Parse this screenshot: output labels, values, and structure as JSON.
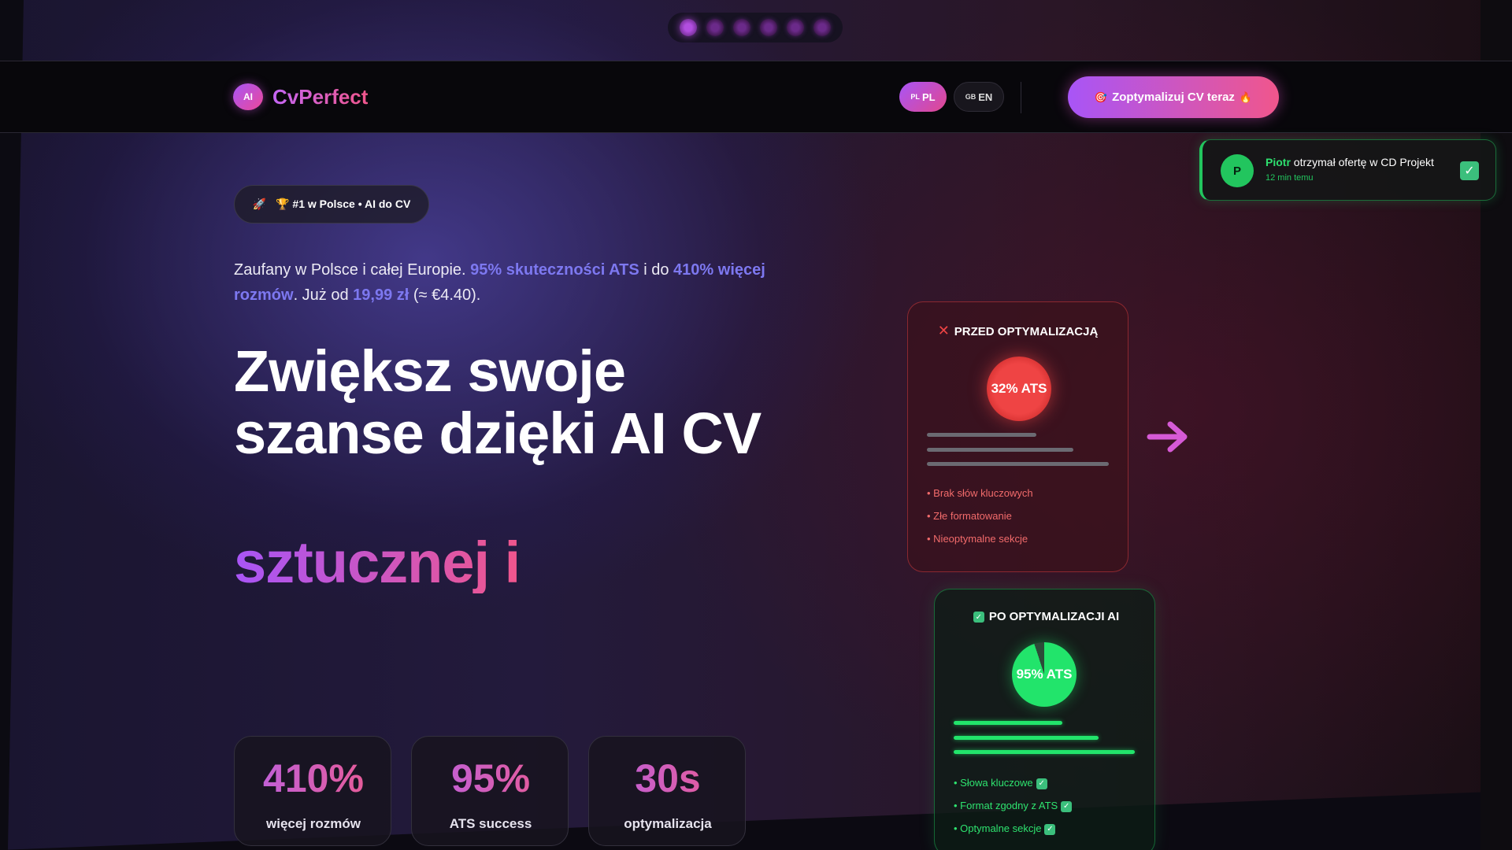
{
  "slider": {
    "dots": 6,
    "active_index": 0
  },
  "header": {
    "logo_badge": "AI",
    "logo_text": "CvPerfect",
    "lang_pl_flag": "PL",
    "lang_pl": "PL",
    "lang_en_flag": "GB",
    "lang_en": "EN",
    "cta_icon": "🎯",
    "cta_label": "Zoptymalizuj CV teraz",
    "cta_icon_end": "🔥"
  },
  "toast": {
    "avatar": "P",
    "name": "Piotr",
    "message": "otrzymał ofertę w CD Projekt",
    "time": "12 min temu",
    "check": "✓"
  },
  "hero": {
    "badge_icon": "🚀",
    "badge_text": "🏆 #1 w Polsce • AI do CV",
    "lead_1": "Zaufany w Polsce i całej Europie. ",
    "lead_hl_1": "95% skuteczności ATS",
    "lead_2": " i do ",
    "lead_hl_2": "410% więcej rozmów",
    "lead_3": ". Już od ",
    "lead_hl_3": "19,99 zł",
    "lead_4": " (≈ €4.40).",
    "headline": "Zwiększ swoje szanse dzięki AI CV",
    "headline_gradient": "sztucznej i"
  },
  "stats": [
    {
      "value": "410%",
      "label": "więcej rozmów"
    },
    {
      "value": "95%",
      "label": "ATS success"
    },
    {
      "value": "30s",
      "label": "optymalizacja"
    }
  ],
  "before": {
    "icon": "✕",
    "title": "PRZED OPTYMALIZACJĄ",
    "score": "32% ATS",
    "score_value": 32,
    "items": [
      "• Brak słów kluczowych",
      "• Złe formatowanie",
      "• Nieoptymalne sekcje"
    ]
  },
  "after": {
    "icon": "✓",
    "title": "PO OPTYMALIZACJI AI",
    "score": "95% ATS",
    "score_value": 95,
    "items": [
      "• Słowa kluczowe",
      "• Format zgodny z ATS",
      "• Optymalne sekcje"
    ],
    "item_check": "✓"
  },
  "colors": {
    "accent_purple": "#a855f7",
    "accent_pink": "#f0568c",
    "success_green": "#22c55e",
    "danger_red": "#ef4444"
  }
}
